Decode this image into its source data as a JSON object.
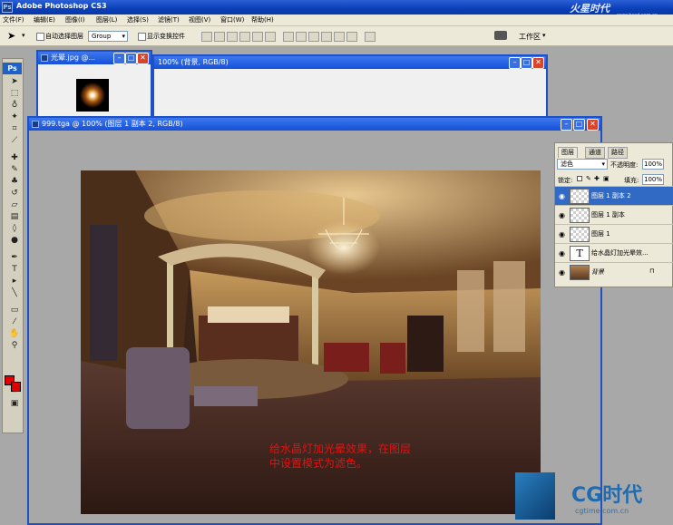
{
  "window": {
    "title": "Adobe Photoshop CS3",
    "app_icon": "Ps"
  },
  "watermark": {
    "top_logo": "火星时代",
    "top_url": "www.hxsd.com.cn",
    "bottom_logo": "CG时代",
    "bottom_url": "cgtime.com.cn"
  },
  "menus": [
    "文件(F)",
    "编辑(E)",
    "图像(I)",
    "图层(L)",
    "选择(S)",
    "滤镜(T)",
    "视图(V)",
    "窗口(W)",
    "帮助(H)"
  ],
  "options": {
    "auto_select_label": "自动选择图层",
    "group_value": "Group",
    "show_transform_label": "显示变换控件",
    "workspace_label": "工作区"
  },
  "toolbox": {
    "badge": "Ps"
  },
  "doc1": {
    "title": "光晕.jpg @..."
  },
  "doc2": {
    "title": "100% (背景, RGB/8)"
  },
  "doc3": {
    "title": "999.tga @ 100% (图层 1 副本 2, RGB/8)"
  },
  "canvas": {
    "annotation_line1": "给水晶灯加光晕效果，在图层",
    "annotation_line2": "中设置模式为滤色。"
  },
  "layers_panel": {
    "tabs": [
      "图层",
      "通道",
      "路径"
    ],
    "blend_mode": "滤色",
    "opacity_label": "不透明度:",
    "opacity_value": "100%",
    "lock_label": "锁定:",
    "fill_label": "填充:",
    "fill_value": "100%",
    "layers": [
      {
        "name": "图层 1 副本 2"
      },
      {
        "name": "图层 1 副本"
      },
      {
        "name": "图层 1"
      },
      {
        "name": "给水晶灯加光晕效..."
      },
      {
        "name": "背景"
      }
    ]
  },
  "colors": {
    "foreground": "#e00000",
    "background": "#e00000",
    "selection": "#316ac5",
    "titlebar": "#0a3fb8"
  }
}
